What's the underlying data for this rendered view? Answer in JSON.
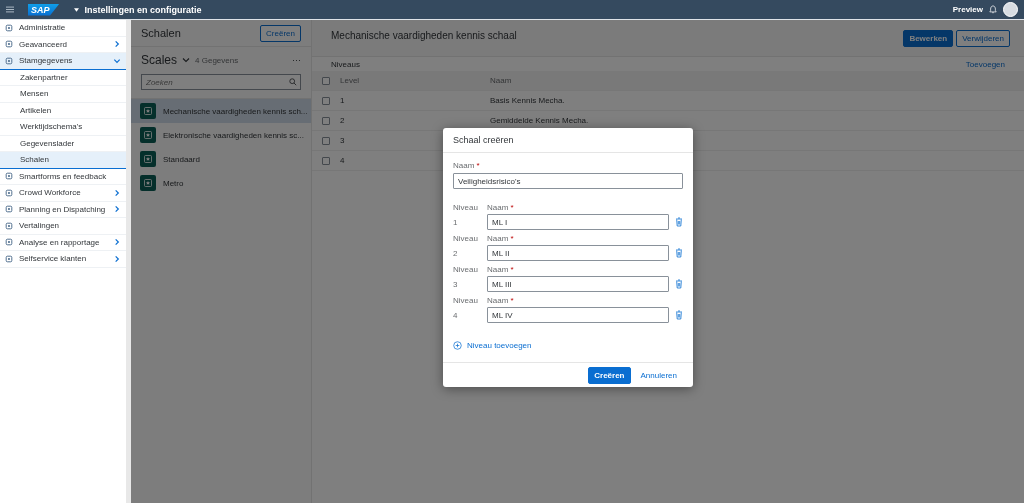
{
  "header": {
    "logo": "SAP",
    "title": "Instellingen en configuratie",
    "preview": "Preview"
  },
  "nav": {
    "items": [
      {
        "label": "Administratie",
        "selected": false
      },
      {
        "label": "Geavanceerd",
        "expanded": false,
        "selected": false
      },
      {
        "label": "Stamgegevens",
        "expanded": true,
        "selected": true,
        "children": [
          {
            "label": "Zakenpartner",
            "selected": false
          },
          {
            "label": "Mensen",
            "selected": false
          },
          {
            "label": "Artikelen",
            "selected": false
          },
          {
            "label": "Werktijdschema's",
            "selected": false
          },
          {
            "label": "Gegevenslader",
            "selected": false
          },
          {
            "label": "Schalen",
            "selected": true
          }
        ]
      },
      {
        "label": "Smartforms en feedback",
        "selected": false
      },
      {
        "label": "Crowd Workforce",
        "expanded": false,
        "selected": false
      },
      {
        "label": "Planning en Dispatching",
        "expanded": false,
        "selected": false
      },
      {
        "label": "Vertalingen",
        "selected": false
      },
      {
        "label": "Analyse en rapportage",
        "expanded": false,
        "selected": false
      },
      {
        "label": "Selfservice klanten",
        "expanded": false,
        "selected": false
      }
    ]
  },
  "master": {
    "title": "Schalen",
    "create_button": "Creëren",
    "list_title": "Scales",
    "count": "4 Gegevens",
    "more": "···",
    "search": {
      "placeholder": "Zoeken"
    },
    "items": [
      {
        "label": "Mechanische vaardigheden kennis sch...",
        "selected": true
      },
      {
        "label": "Elektronische vaardigheden kennis sc...",
        "selected": false
      },
      {
        "label": "Standaard",
        "selected": false
      },
      {
        "label": "Metro",
        "selected": false
      }
    ]
  },
  "detail": {
    "title": "Mechanische vaardigheden kennis schaal",
    "buttons": [
      {
        "label": "Bewerken",
        "kind": "primary"
      },
      {
        "label": "Verwijderen",
        "kind": "secondary"
      }
    ],
    "section": "Niveaus",
    "add": "Toevoegen",
    "all_checked": false,
    "columns": [
      "Level",
      "Naam"
    ],
    "rows": [
      {
        "level": "1",
        "name": "Basis Kennis Mecha.",
        "checked": false
      },
      {
        "level": "2",
        "name": "Gemiddelde Kennis Mecha.",
        "checked": false
      },
      {
        "level": "3",
        "checked": false
      },
      {
        "level": "4",
        "checked": false
      }
    ]
  },
  "dialog": {
    "title": "Schaal creëren",
    "name_label": "Naam",
    "required_mark": "*",
    "name_value": "Veiligheidsrisico's",
    "levels": [
      {
        "level_label": "Niveau",
        "number": "1",
        "label": "Naam",
        "value": "ML I"
      },
      {
        "level_label": "Niveau",
        "number": "2",
        "label": "Naam",
        "value": "ML II"
      },
      {
        "level_label": "Niveau",
        "number": "3",
        "label": "Naam",
        "value": "ML III"
      },
      {
        "level_label": "Niveau",
        "number": "4",
        "label": "Naam",
        "value": "ML IV"
      }
    ],
    "add": "Niveau toevoegen",
    "buttons": [
      {
        "label": "Creëren",
        "kind": "primary"
      },
      {
        "label": "Annuleren",
        "kind": "transparent"
      }
    ]
  }
}
